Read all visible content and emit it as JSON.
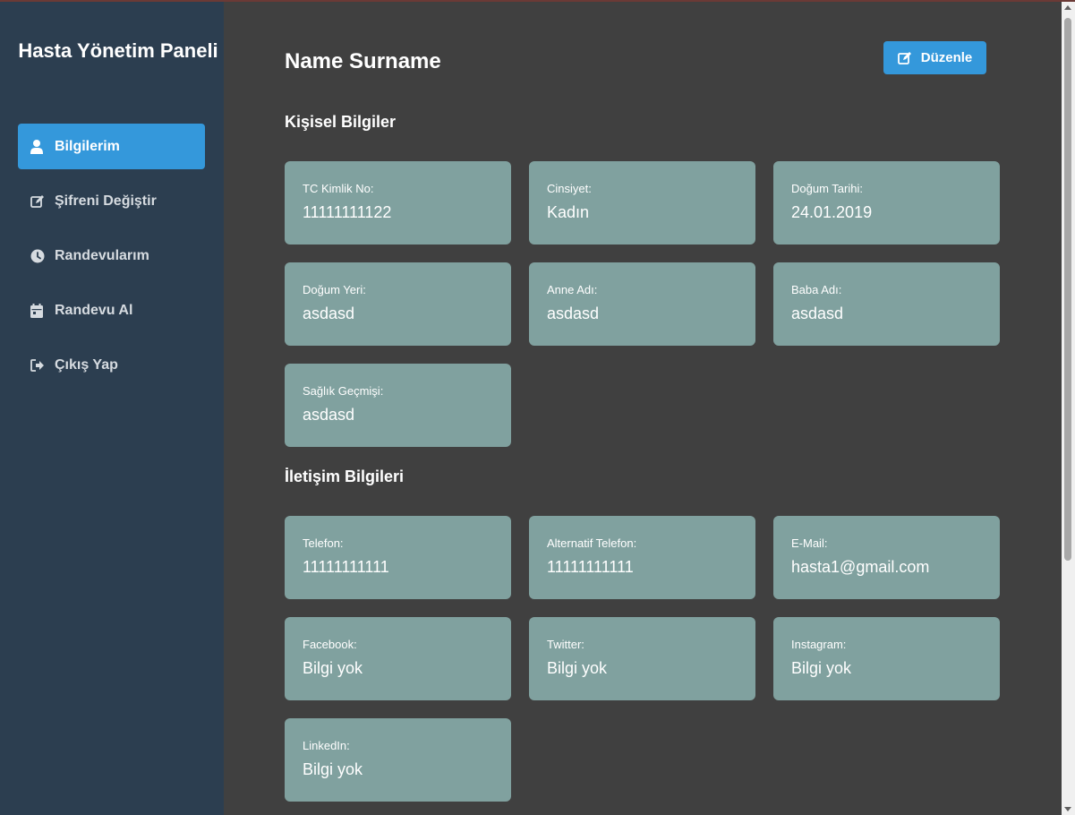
{
  "sidebar": {
    "title": "Hasta Yönetim Paneli",
    "items": [
      {
        "label": "Bilgilerim",
        "icon": "user-icon",
        "active": true
      },
      {
        "label": "Şifreni Değiştir",
        "icon": "edit-icon",
        "active": false
      },
      {
        "label": "Randevularım",
        "icon": "clock-icon",
        "active": false
      },
      {
        "label": "Randevu Al",
        "icon": "calendar-icon",
        "active": false
      },
      {
        "label": "Çıkış Yap",
        "icon": "sign-out-icon",
        "active": false
      }
    ]
  },
  "main": {
    "title": "Name Surname",
    "edit_button": {
      "label": "Düzenle",
      "icon": "edit-icon"
    },
    "personal": {
      "title": "Kişisel Bilgiler",
      "fields": [
        {
          "label": "TC Kimlik No:",
          "value": "11111111122"
        },
        {
          "label": "Cinsiyet:",
          "value": "Kadın"
        },
        {
          "label": "Doğum Tarihi:",
          "value": "24.01.2019"
        },
        {
          "label": "Doğum Yeri:",
          "value": "asdasd"
        },
        {
          "label": "Anne Adı:",
          "value": "asdasd"
        },
        {
          "label": "Baba Adı:",
          "value": "asdasd"
        },
        {
          "label": "Sağlık Geçmişi:",
          "value": "asdasd"
        }
      ]
    },
    "contact": {
      "title": "İletişim Bilgileri",
      "fields": [
        {
          "label": "Telefon:",
          "value": "11111111111"
        },
        {
          "label": "Alternatif Telefon:",
          "value": "11111111111"
        },
        {
          "label": "E-Mail:",
          "value": "hasta1@gmail.com"
        },
        {
          "label": "Facebook:",
          "value": "Bilgi yok"
        },
        {
          "label": "Twitter:",
          "value": "Bilgi yok"
        },
        {
          "label": "Instagram:",
          "value": "Bilgi yok"
        },
        {
          "label": "LinkedIn:",
          "value": "Bilgi yok"
        }
      ]
    }
  },
  "colors": {
    "sidebar_bg": "#2c3e50",
    "accent": "#3498db",
    "content_bg": "#404040",
    "card_bg": "#80a19f"
  }
}
